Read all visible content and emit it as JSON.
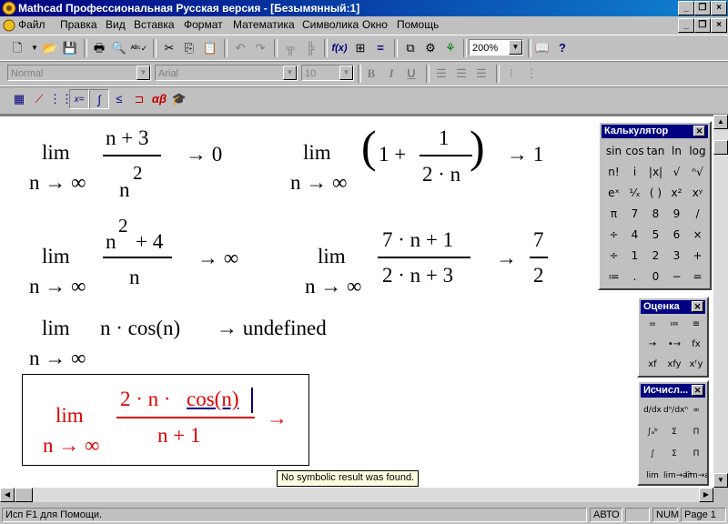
{
  "window": {
    "title": "Mathcad Профессиональная Русская версия - [Безымянный:1]",
    "controls": [
      "_",
      "❐",
      "×"
    ],
    "doc_controls": [
      "_",
      "❐",
      "×"
    ]
  },
  "menu": [
    "Файл",
    "Правка",
    "Вид",
    "Вставка",
    "Формат",
    "Математика",
    "Символика",
    "Окно",
    "Помощь"
  ],
  "toolbar": {
    "zoom": "200%"
  },
  "format_bar": {
    "style": "Normal",
    "font": "Arial",
    "size": "10",
    "bold": "B",
    "italic": "I",
    "underline": "U"
  },
  "worksheet": {
    "lim": "lim",
    "sub": "n → ∞",
    "e1": {
      "num": "n + 3",
      "den_base": "n",
      "den_exp": "2",
      "result": "→ 0"
    },
    "e2": {
      "lparen": "(",
      "one_plus": "1 +",
      "num": "1",
      "den": "2 · n",
      "rparen": ")",
      "result": "→ 1"
    },
    "e3": {
      "num_base": "n",
      "num_exp": "2",
      "num_rest": "+ 4",
      "den": "n",
      "result": "→ ∞"
    },
    "e4": {
      "num": "7 · n + 1",
      "den": "2 · n + 3",
      "arrow": "→",
      "res_num": "7",
      "res_den": "2"
    },
    "e5": {
      "body": "n · cos(n)",
      "result": "→ undefined"
    },
    "e6": {
      "num_a": "2 · n · ",
      "num_b": "cos(n)",
      "den": "n + 1",
      "arrow": "→"
    }
  },
  "tooltip": "No symbolic result was found.",
  "status": {
    "help": "Исп F1 для Помощи.",
    "mode": "АВТО",
    "num": "NUM",
    "page": "Page 1"
  },
  "palettes": {
    "calculator": {
      "title": "Калькулятор",
      "keys": [
        "sin",
        "cos",
        "tan",
        "ln",
        "log",
        "n!",
        "i",
        "|x|",
        "√",
        "ⁿ√",
        "eˣ",
        "¹⁄ₓ",
        "( )",
        "x²",
        "xʸ",
        "π",
        "7",
        "8",
        "9",
        "/",
        "÷",
        "4",
        "5",
        "6",
        "×",
        "÷",
        "1",
        "2",
        "3",
        "+",
        "≔",
        ".",
        "0",
        "−",
        "="
      ]
    },
    "evaluation": {
      "title": "Оценка",
      "keys": [
        "=",
        "≔",
        "≡",
        "→",
        "•→",
        "fx",
        "xf",
        "xfy",
        "xᶠy"
      ]
    },
    "calculus": {
      "title": "Исчисл...",
      "keys": [
        "d/dx",
        "dⁿ/dxⁿ",
        "∞",
        "∫ₐᵇ",
        "Σ",
        "Π",
        "∫",
        "Σ",
        "Π",
        "lim",
        "lim→a⁺",
        "lim→a⁻"
      ]
    }
  }
}
